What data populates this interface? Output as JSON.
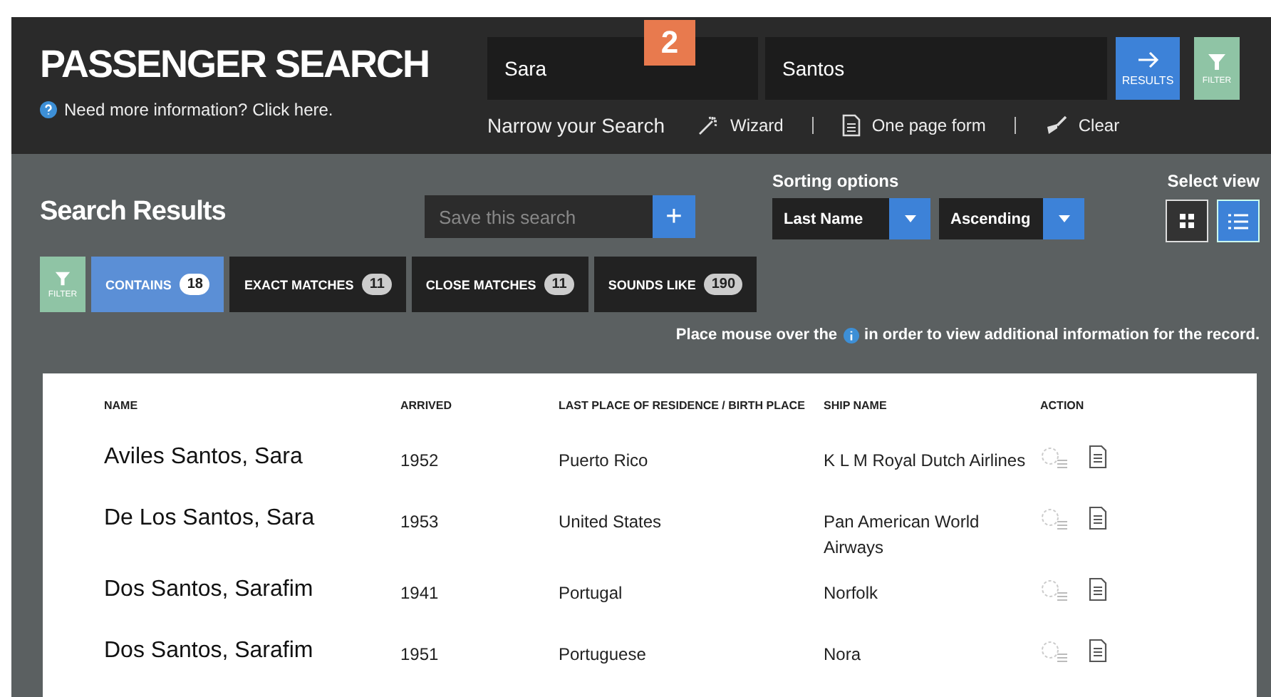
{
  "header": {
    "title": "PASSENGER SEARCH",
    "help_text": "Need more information? Click here.",
    "callout": "2",
    "first_name": "Sara",
    "last_name": "Santos",
    "results_button": "RESULTS",
    "filter_button": "FILTER",
    "narrow_label": "Narrow your Search",
    "links": [
      {
        "kind": "wizard",
        "label": "Wizard"
      },
      {
        "kind": "form",
        "label": "One page form"
      },
      {
        "kind": "clear",
        "label": "Clear"
      }
    ]
  },
  "results": {
    "title": "Search Results",
    "save_placeholder": "Save this search",
    "add_button": "+",
    "sorting_label": "Sorting options",
    "sort_field": "Last Name",
    "sort_order": "Ascending",
    "view_label": "Select view",
    "views": [
      {
        "kind": "grid",
        "selected": false
      },
      {
        "kind": "list",
        "selected": true
      }
    ],
    "filter_button": "FILTER",
    "match_tabs": [
      {
        "label": "CONTAINS",
        "count": "18",
        "selected": true
      },
      {
        "label": "EXACT MATCHES",
        "count": "11",
        "selected": false
      },
      {
        "label": "CLOSE MATCHES",
        "count": "11",
        "selected": false
      },
      {
        "label": "SOUNDS LIKE",
        "count": "190",
        "selected": false
      }
    ],
    "hint_before": "Place mouse over the",
    "hint_after": "in order to view additional information for the record."
  },
  "table": {
    "columns": [
      "NAME",
      "ARRIVED",
      "LAST PLACE OF RESIDENCE / BIRTH PLACE",
      "SHIP NAME",
      "ACTION"
    ],
    "rows": [
      {
        "name": "Aviles Santos, Sara",
        "arrived": "1952",
        "place": "Puerto Rico",
        "ship": "K L M Royal Dutch Airlines"
      },
      {
        "name": "De Los Santos, Sara",
        "arrived": "1953",
        "place": "United States",
        "ship": "Pan American World Airways"
      },
      {
        "name": "Dos Santos, Sarafim",
        "arrived": "1941",
        "place": "Portugal",
        "ship": "Norfolk"
      },
      {
        "name": "Dos Santos, Sarafim",
        "arrived": "1951",
        "place": "Portuguese",
        "ship": "Nora"
      }
    ]
  }
}
